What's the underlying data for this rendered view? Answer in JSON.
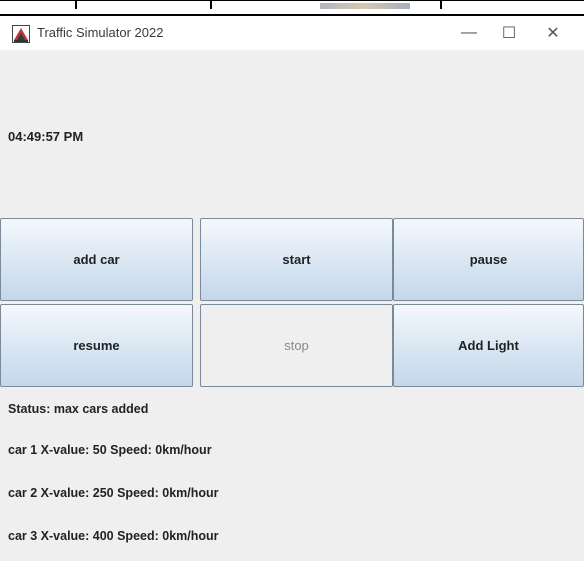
{
  "window": {
    "title": "Traffic Simulator 2022",
    "controls": {
      "minimize": "—",
      "maximize": "☐",
      "close": "✕"
    }
  },
  "clock": "04:49:57 PM",
  "buttons": [
    {
      "label": "add car",
      "enabled": true
    },
    {
      "label": "start",
      "enabled": true
    },
    {
      "label": "pause",
      "enabled": true
    },
    {
      "label": "resume",
      "enabled": true
    },
    {
      "label": "stop",
      "enabled": false
    },
    {
      "label": "Add Light",
      "enabled": true
    }
  ],
  "status": "Status: max cars added",
  "cars": [
    "car 1 X-value: 50 Speed: 0km/hour",
    "car 2 X-value: 250 Speed: 0km/hour",
    "car 3 X-value: 400 Speed: 0km/hour"
  ],
  "colors": {
    "window_bg": "#efefef",
    "button_gradient_top": "#f4f8fc",
    "button_gradient_bottom": "#c4d7ea",
    "button_border": "#7a8a99",
    "disabled_text": "#8a8a8a"
  }
}
